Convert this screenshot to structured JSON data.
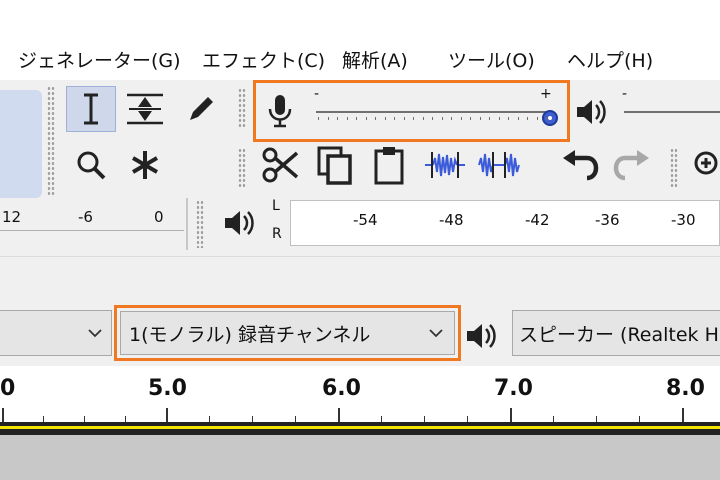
{
  "menu": {
    "items": [
      {
        "label": "ジェネレーター(G)"
      },
      {
        "label": "エフェクト(C)"
      },
      {
        "label": "解析(A)"
      },
      {
        "label": "ツール(O)"
      },
      {
        "label": "ヘルプ(H)"
      }
    ]
  },
  "toolbar": {
    "tools": {
      "selection": "selection-tool",
      "envelope": "envelope-tool",
      "draw": "draw-tool",
      "zoom": "zoom-tool",
      "multi": "multi-tool"
    },
    "edit": [
      "cut",
      "copy",
      "paste",
      "trim",
      "silence",
      "undo",
      "redo",
      "zoom-in"
    ]
  },
  "record_meter": {
    "minus_label": "-",
    "plus_label": "+",
    "level": 1.0
  },
  "playback_meter": {
    "minus_label": "-"
  },
  "meter_scale": {
    "left_labels": [
      "12",
      "-6",
      "0"
    ],
    "channel_labels": [
      "L",
      "R"
    ],
    "labels": [
      "-54",
      "-48",
      "-42",
      "-36",
      "-30"
    ]
  },
  "devices": {
    "host_select_value": "",
    "channels_select_value": "1(モノラル) 録音チャンネル",
    "output_select_value": "スピーカー (Realtek H"
  },
  "timeline": {
    "labels": [
      "0",
      "5.0",
      "6.0",
      "7.0",
      "8.0"
    ]
  },
  "colors": {
    "highlight": "#f07820",
    "active_tool_bg": "#cfd8ea",
    "slider_thumb": "#3d5fcf",
    "waveform_blue": "#3b5bdb"
  }
}
